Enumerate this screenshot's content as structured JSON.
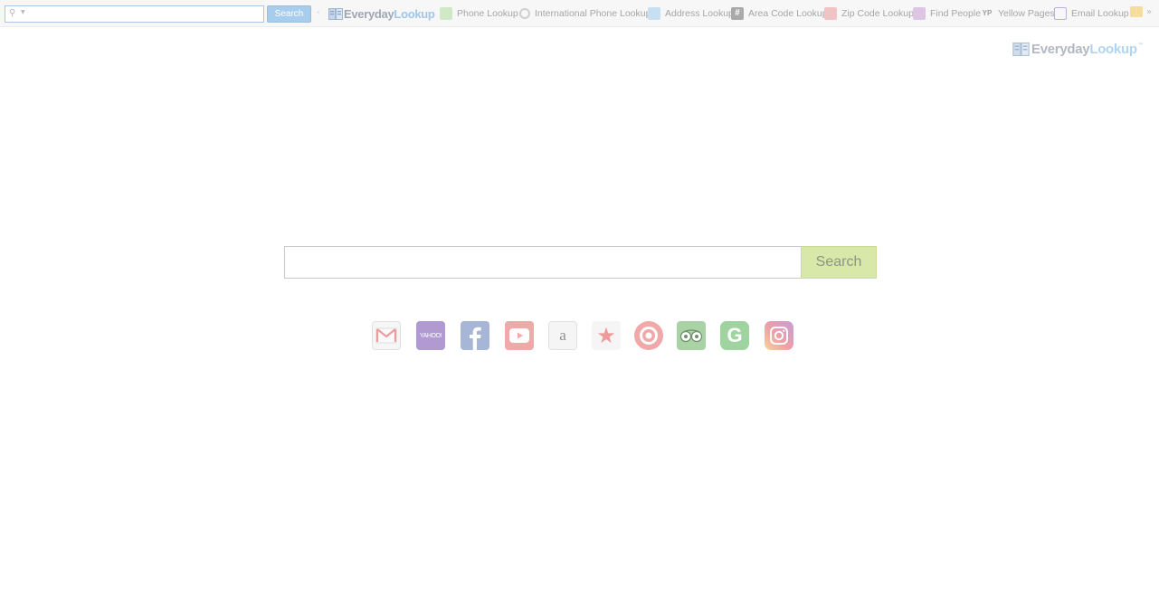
{
  "toolbar": {
    "search_placeholder": "",
    "search_button": "Search",
    "logo": {
      "part1": "Everyday",
      "part2": "Lookup"
    },
    "links": [
      {
        "label": "Phone Lookup",
        "icon": "phone-icon"
      },
      {
        "label": "International Phone Lookup",
        "icon": "globe-icon"
      },
      {
        "label": "Address Lookup",
        "icon": "house-icon"
      },
      {
        "label": "Area Code Lookup",
        "icon": "hash-icon"
      },
      {
        "label": "Zip Code Lookup",
        "icon": "zip-icon"
      },
      {
        "label": "Find People",
        "icon": "people-icon"
      },
      {
        "label": "Yellow Pages",
        "icon": "yp-icon"
      },
      {
        "label": "Email Lookup",
        "icon": "email-icon"
      }
    ],
    "hash_glyph": "#",
    "yp_glyph": "YP",
    "more_glyph": "»"
  },
  "main": {
    "logo": {
      "part1": "Everyday",
      "part2": "Lookup",
      "tm": "™"
    },
    "search_placeholder": "",
    "search_button": "Search",
    "quick_links": [
      {
        "name": "gmail",
        "icon": "gmail-icon"
      },
      {
        "name": "yahoo",
        "icon": "yahoo-icon",
        "text": "YAHOO!"
      },
      {
        "name": "facebook",
        "icon": "facebook-icon"
      },
      {
        "name": "youtube",
        "icon": "youtube-icon"
      },
      {
        "name": "amazon",
        "icon": "amazon-icon",
        "text": "a"
      },
      {
        "name": "favorites",
        "icon": "star-icon",
        "text": "★"
      },
      {
        "name": "target",
        "icon": "target-icon"
      },
      {
        "name": "tripadvisor",
        "icon": "tripadvisor-icon"
      },
      {
        "name": "grammarly",
        "icon": "grammarly-icon",
        "text": "G"
      },
      {
        "name": "instagram",
        "icon": "instagram-icon"
      }
    ]
  },
  "colors": {
    "toolbar_search_button": "#a8cdec",
    "main_search_button": "#d8e8a8",
    "logo_grey": "#a0a7b4",
    "logo_blue": "#9ec7ea"
  }
}
